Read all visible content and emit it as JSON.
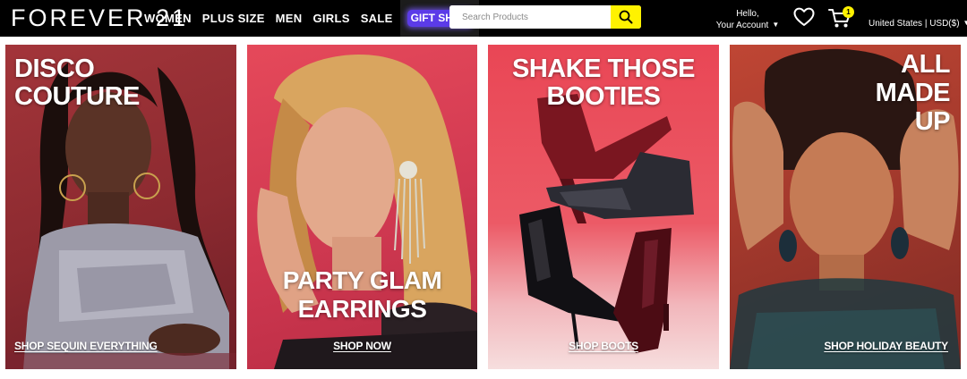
{
  "brand": {
    "logo_text": "FOREVER 21"
  },
  "nav": {
    "items": [
      {
        "label": "WOMEN"
      },
      {
        "label": "PLUS SIZE"
      },
      {
        "label": "MEN"
      },
      {
        "label": "GIRLS"
      },
      {
        "label": "SALE"
      }
    ],
    "gift_shop": "GIFT SHOP"
  },
  "search": {
    "placeholder": "Search Products",
    "icon": "search-icon"
  },
  "account": {
    "greeting": "Hello,",
    "label": "Your Account"
  },
  "cart": {
    "count": "1"
  },
  "region": {
    "label": "United States | USD($)"
  },
  "colors": {
    "topbar": "#000000",
    "search_button": "#fff200",
    "gift_shop_highlight": "#5b3be8"
  },
  "tiles": [
    {
      "headline": "DISCO\nCOUTURE",
      "cta": "SHOP SEQUIN EVERYTHING"
    },
    {
      "headline": "PARTY GLAM\nEARRINGS",
      "cta": "SHOP NOW"
    },
    {
      "headline": "SHAKE THOSE\nBOOTIES",
      "cta": "SHOP BOOTS"
    },
    {
      "headline": "ALL\nMADE\nUP",
      "cta": "SHOP HOLIDAY BEAUTY"
    }
  ]
}
